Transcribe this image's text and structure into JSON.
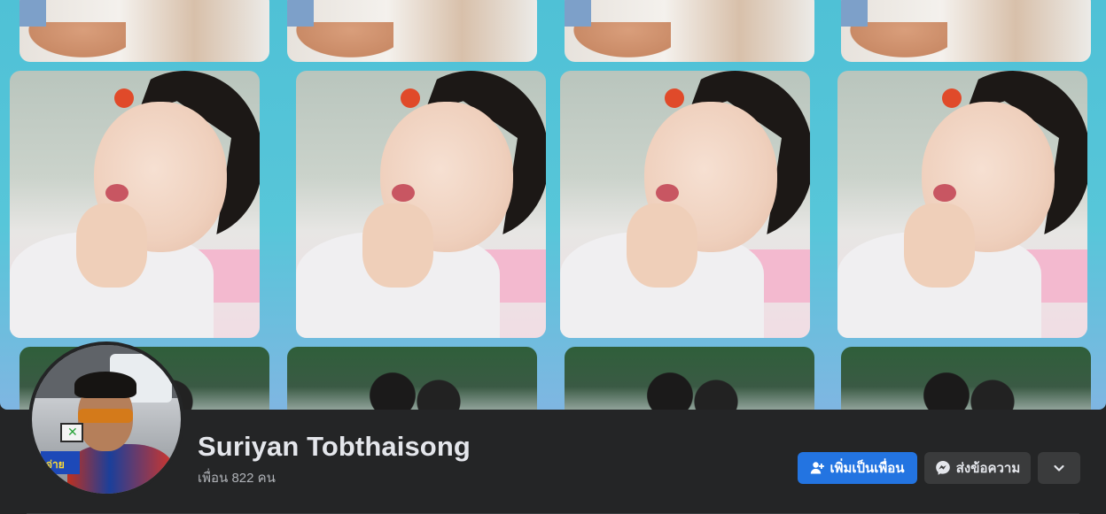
{
  "profile": {
    "name": "Suriyan Tobthaisong",
    "friends_count": "เพื่อน 822 คน",
    "avatar_badge_text": "จ่าย"
  },
  "actions": {
    "add_friend_label": "เพิ่มเป็นเพื่อน",
    "add_friend_icon": "add-friend-icon",
    "message_label": "ส่งข้อความ",
    "message_icon": "messenger-icon",
    "more_icon": "chevron-down-icon"
  },
  "colors": {
    "background": "#242526",
    "primary_button": "#2374e1",
    "secondary_button": "#3a3b3c",
    "name_text": "#e4e6eb",
    "secondary_text": "#b0b3b8",
    "cover_tint": "#4fc1d6"
  }
}
